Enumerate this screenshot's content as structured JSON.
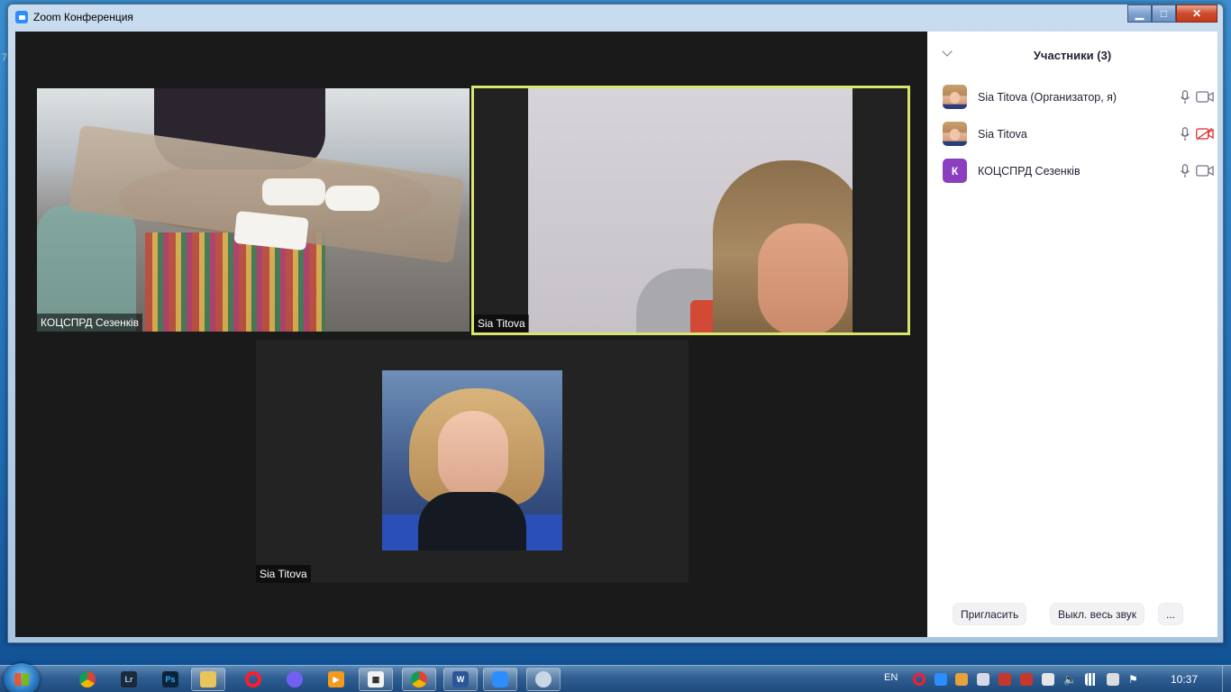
{
  "window": {
    "title": "Zoom Конференция",
    "controls": {
      "minimize": "▁",
      "maximize": "□",
      "close": "✕"
    }
  },
  "videos": [
    {
      "name": "КОЦСПРД Сезенків",
      "active_speaker": false
    },
    {
      "name": "Sia Titova",
      "active_speaker": true
    },
    {
      "name": "Sia Titova",
      "active_speaker": false
    }
  ],
  "participants_panel": {
    "title": "Участники (3)",
    "participants": [
      {
        "name": "Sia Titova (Организатор, я)",
        "avatar": "photo",
        "mic": "on",
        "video": "on"
      },
      {
        "name": "Sia Titova",
        "avatar": "photo",
        "mic": "on",
        "video": "off"
      },
      {
        "name": "КОЦСПРД Сезенків",
        "avatar": "letter",
        "avatar_letter": "К",
        "avatar_color": "#8b3fbf",
        "mic": "on",
        "video": "on"
      }
    ],
    "buttons": {
      "invite": "Пригласить",
      "mute_all": "Выкл. весь звук",
      "more": "..."
    }
  },
  "taskbar": {
    "apps": [
      {
        "name": "chrome-icon",
        "label": ""
      },
      {
        "name": "lightroom-icon",
        "label": "Lr"
      },
      {
        "name": "photoshop-icon",
        "label": "Ps"
      },
      {
        "name": "explorer-icon",
        "label": ""
      },
      {
        "name": "opera-icon",
        "label": ""
      },
      {
        "name": "viber-icon",
        "label": ""
      },
      {
        "name": "media-player-icon",
        "label": ""
      },
      {
        "name": "calendar-icon",
        "label": ""
      },
      {
        "name": "chrome-icon",
        "label": ""
      },
      {
        "name": "word-icon",
        "label": "W"
      },
      {
        "name": "zoom-icon",
        "label": ""
      },
      {
        "name": "paint-icon",
        "label": ""
      }
    ],
    "language": "EN",
    "clock": "10:37"
  },
  "colors": {
    "active_speaker_border": "#d9e56c",
    "panel_background": "#ffffff",
    "video_background": "#1a1a1a",
    "muted_video_icon": "#e02828"
  }
}
